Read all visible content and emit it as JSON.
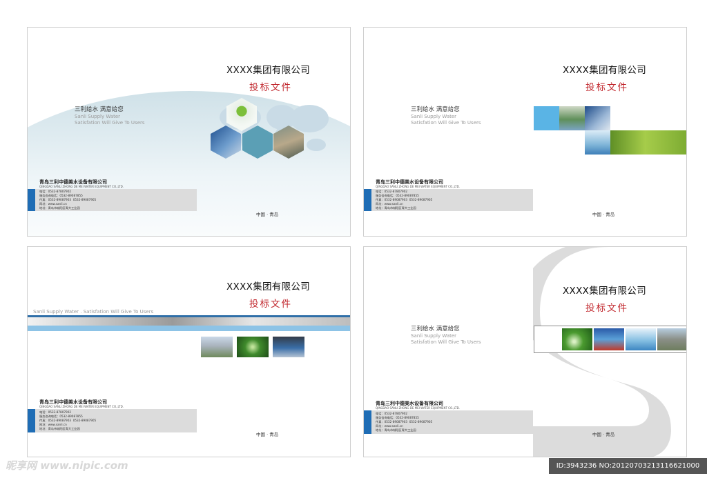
{
  "cover": {
    "company_title": "XXXX集团有限公司",
    "doc_title": "投标文件",
    "slogan_cn": "三利给水  满意给您",
    "slogan_en_line1": "Sanli Supply Water",
    "slogan_en_line2": "Satisfation Will Give To Users",
    "slogan_en_single": "Sanli Supply Water . Satisfation Will Give To Users",
    "company_cn": "青岛三利中德美水设备有限公司",
    "company_en": "QINGDAO SANLI ZHONG DE MEI WATER EQUIPMENT CO.,LTD.",
    "contact": "电话：0532-87807902\n服务咨询电话：0532-89087855\n传真：0532-89087903  0532-89087905\n网址：www.sanli.cn\n地址：青岛市城阳区青大工业园",
    "footer": "中国 · 青岛"
  },
  "watermark": {
    "left": "昵享网 www.nipic.com",
    "right": "ID:3943236 NO:20120703213116621000"
  },
  "colors": {
    "accent_red": "#c1272d",
    "accent_blue": "#1f6db5",
    "light_blue": "#8dc3e6"
  }
}
